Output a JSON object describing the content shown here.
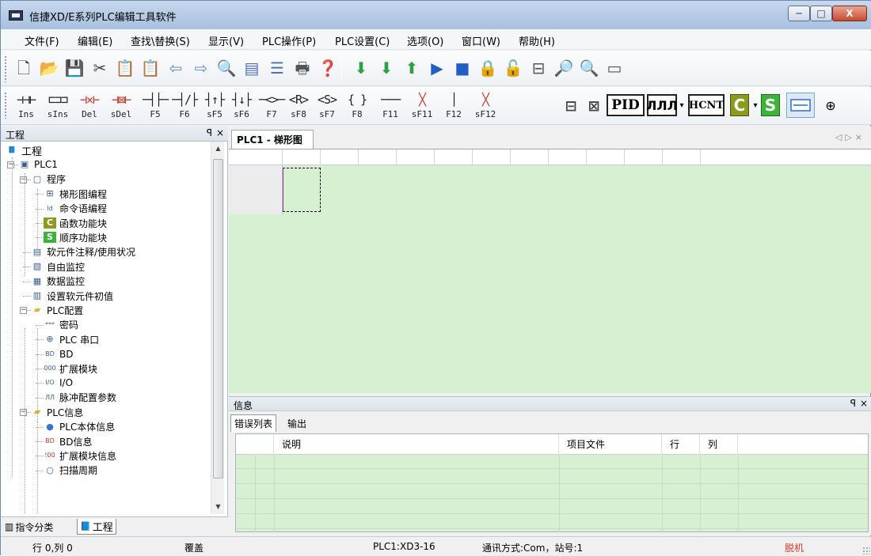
{
  "window": {
    "title": "信捷XD/E系列PLC编辑工具软件",
    "minimize": "─",
    "maximize": "□",
    "close": "X"
  },
  "menu": [
    "文件(F)",
    "编辑(E)",
    "查找\\替换(S)",
    "显示(V)",
    "PLC操作(P)",
    "PLC设置(C)",
    "选项(O)",
    "窗口(W)",
    "帮助(H)"
  ],
  "toolbar1": {
    "icons": [
      "new-file-icon",
      "open-folder-icon",
      "save-icon",
      "cut-icon",
      "copy-icon",
      "paste-icon",
      "back-arrow-icon",
      "forward-arrow-icon",
      "find-icon",
      "properties-icon",
      "list-icon",
      "print-icon",
      "help-icon",
      "download-icon",
      "upload-icon",
      "compare-icon",
      "run-icon",
      "stop-icon",
      "lock-icon",
      "unlock-icon",
      "window-icon",
      "monitor-icon",
      "preview-icon",
      "connect-icon"
    ],
    "glyphs": [
      "🗋",
      "📂",
      "💾",
      "✂",
      "📋",
      "📋",
      "⇦",
      "⇨",
      "🔍",
      "▤",
      "☰",
      "🖶",
      "❓",
      "⬇",
      "⬇",
      "⬆",
      "▶",
      "■",
      "🔒",
      "🔓",
      "⊟",
      "🔎",
      "🔍",
      "▭"
    ]
  },
  "ladder_tools": [
    {
      "sym": "⊣⊣⊢",
      "key": "Ins"
    },
    {
      "sym": "⊏⊐⊐",
      "key": "sIns"
    },
    {
      "sym": "⊣✕⊢",
      "key": "Del"
    },
    {
      "sym": "⊣⊠⊢",
      "key": "sDel"
    },
    {
      "sym": "─┤├─",
      "key": "F5"
    },
    {
      "sym": "─┤/├",
      "key": "F6"
    },
    {
      "sym": "┤↑├",
      "key": "sF5"
    },
    {
      "sym": "┤↓├",
      "key": "sF6"
    },
    {
      "sym": "─<>─",
      "key": "F7"
    },
    {
      "sym": "<R>",
      "key": "sF8"
    },
    {
      "sym": "<S>",
      "key": "sF7"
    },
    {
      "sym": "{ }",
      "key": "F8"
    },
    {
      "sym": "───",
      "key": "F11"
    },
    {
      "sym": "╳",
      "key": "sF11"
    },
    {
      "sym": "│",
      "key": "F12"
    },
    {
      "sym": "╳",
      "key": "sF12"
    }
  ],
  "toolbar2_right": {
    "pid": "PID",
    "pulse": "ЛЛЛ",
    "hcnt": "HCNT",
    "c_block": "C",
    "s_block": "S",
    "zoom": "⊕",
    "dropdown": "▾"
  },
  "left_panel": {
    "title": "工程",
    "pin": "ꟼ",
    "close": "×",
    "tree": [
      {
        "label": "工程",
        "icon": "project-icon",
        "glyph": "📘"
      },
      {
        "label": "PLC1",
        "icon": "plc-icon",
        "glyph": "▣"
      },
      {
        "label": "程序",
        "icon": "program-icon",
        "glyph": "▢"
      },
      {
        "label": "梯形图编程",
        "icon": "ladder-icon",
        "glyph": "⊞"
      },
      {
        "label": "命令语编程",
        "icon": "instruction-icon",
        "glyph": "ld"
      },
      {
        "label": "函数功能块",
        "icon": "function-block-icon",
        "glyph": "C"
      },
      {
        "label": "顺序功能块",
        "icon": "sequence-block-icon",
        "glyph": "S"
      },
      {
        "label": "软元件注释/使用状况",
        "icon": "device-comment-icon",
        "glyph": "▤"
      },
      {
        "label": "自由监控",
        "icon": "free-monitor-icon",
        "glyph": "▧"
      },
      {
        "label": "数据监控",
        "icon": "data-monitor-icon",
        "glyph": "▦"
      },
      {
        "label": "设置软元件初值",
        "icon": "device-init-icon",
        "glyph": "▥"
      },
      {
        "label": "PLC配置",
        "icon": "folder-icon",
        "glyph": "▰"
      },
      {
        "label": "密码",
        "icon": "password-icon",
        "glyph": "***"
      },
      {
        "label": "PLC 串口",
        "icon": "serial-port-icon",
        "glyph": "⊕"
      },
      {
        "label": "BD",
        "icon": "bd-icon",
        "glyph": "BD"
      },
      {
        "label": "扩展模块",
        "icon": "expansion-icon",
        "glyph": "000"
      },
      {
        "label": "I/O",
        "icon": "io-icon",
        "glyph": "I/O"
      },
      {
        "label": "脉冲配置参数",
        "icon": "pulse-icon",
        "glyph": "ЛЛ"
      },
      {
        "label": "PLC信息",
        "icon": "folder-icon",
        "glyph": "▰"
      },
      {
        "label": "PLC本体信息",
        "icon": "plc-info-icon",
        "glyph": "●"
      },
      {
        "label": "BD信息",
        "icon": "bd-info-icon",
        "glyph": "BD"
      },
      {
        "label": "扩展模块信息",
        "icon": "expansion-info-icon",
        "glyph": "!00"
      },
      {
        "label": "扫描周期",
        "icon": "scan-cycle-icon",
        "glyph": "○"
      }
    ],
    "tabs": [
      "指令分类",
      "工程"
    ],
    "tab_icons": [
      "▥",
      "📘"
    ]
  },
  "editor": {
    "tab": "PLC1 - 梯形图",
    "nav": "◁▷×"
  },
  "info": {
    "title": "信息",
    "pin": "ꟼ",
    "close": "×",
    "tabs": [
      "错误列表",
      "输出"
    ],
    "columns": [
      "说明",
      "项目文件",
      "行",
      "列"
    ]
  },
  "status": {
    "position": "行 0,列 0",
    "mode": "覆盖",
    "model": "PLC1:XD3-16",
    "comm": "通讯方式:Com，站号:1",
    "state": "脱机"
  },
  "colors": {
    "ladder_bg": "#d8f0d2",
    "offline": "#d8362a"
  }
}
